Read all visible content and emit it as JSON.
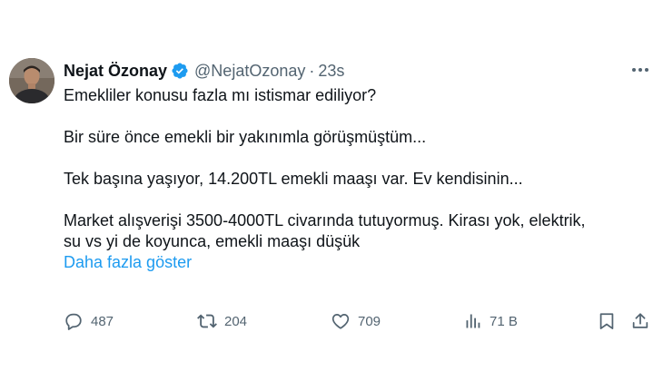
{
  "author": {
    "name": "Nejat Özonay",
    "handle": "@NejatOzonay",
    "separator": "·",
    "time": "23s",
    "verified": true
  },
  "tweet": {
    "lines": [
      "Emekliler konusu fazla mı istismar ediliyor?",
      "Bir süre önce emekli bir yakınımla görüşmüştüm...",
      "Tek başına yaşıyor, 14.200TL emekli maaşı var. Ev kendisinin...",
      "Market alışverişi 3500-4000TL civarında tutuyormuş. Kirası yok, elektrik,",
      "su vs yi de koyunca, emekli maaşı düşük"
    ],
    "show_more": "Daha fazla göster"
  },
  "actions": {
    "reply": {
      "icon": "reply-icon",
      "count": "487"
    },
    "retweet": {
      "icon": "retweet-icon",
      "count": "204"
    },
    "like": {
      "icon": "heart-icon",
      "count": "709"
    },
    "views": {
      "icon": "views-icon",
      "count": "71 B"
    },
    "bookmark": {
      "icon": "bookmark-icon"
    },
    "share": {
      "icon": "share-icon"
    }
  },
  "colors": {
    "text": "#0f1419",
    "secondary": "#536471",
    "accent": "#1d9bf0"
  }
}
